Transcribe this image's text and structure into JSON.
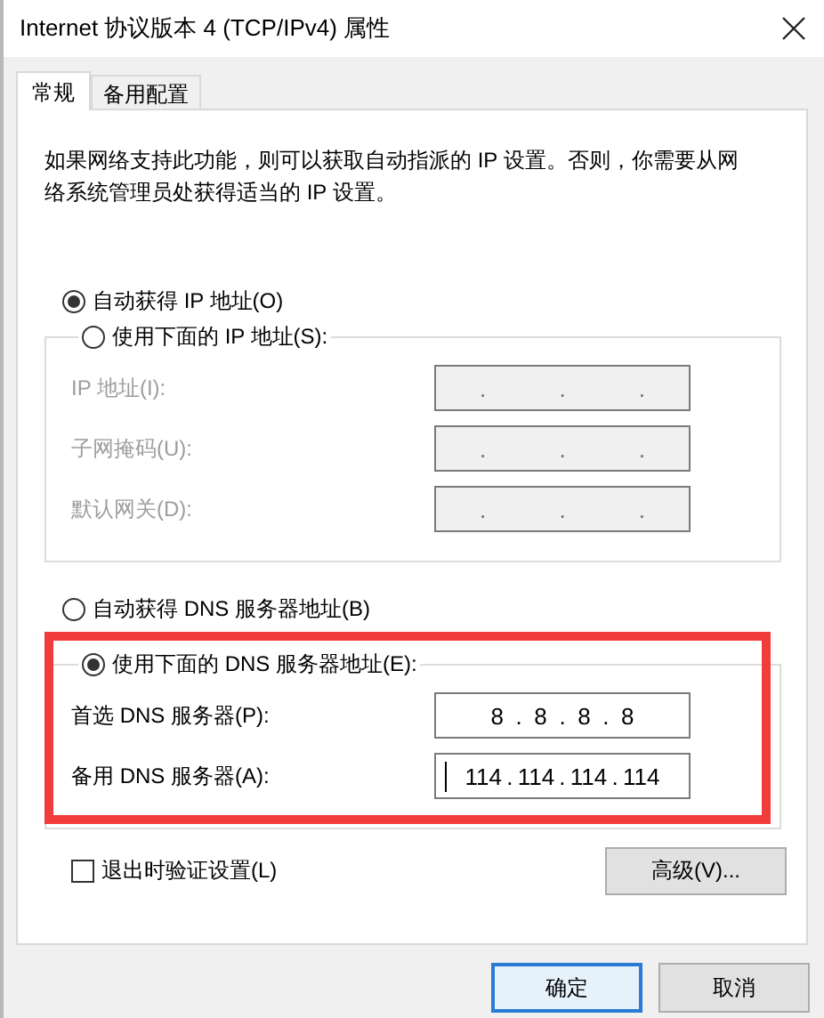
{
  "window": {
    "title": "Internet 协议版本 4 (TCP/IPv4) 属性"
  },
  "tabs": [
    {
      "label": "常规",
      "selected": true
    },
    {
      "label": "备用配置",
      "selected": false
    }
  ],
  "description": "如果网络支持此功能，则可以获取自动指派的 IP 设置。否则，你需要从网络系统管理员处获得适当的 IP 设置。",
  "ip_options": [
    {
      "label": "自动获得 IP 地址(O)",
      "selected": true
    },
    {
      "label": "使用下面的 IP 地址(S):",
      "selected": false
    }
  ],
  "ip_fields": [
    {
      "label": "IP 地址(I):",
      "value": ". . .",
      "disabled": true,
      "focused": false
    },
    {
      "label": "子网掩码(U):",
      "value": ". . .",
      "disabled": true,
      "focused": false
    },
    {
      "label": "默认网关(D):",
      "value": ". . .",
      "disabled": true,
      "focused": false
    }
  ],
  "dns_options": [
    {
      "label": "自动获得 DNS 服务器地址(B)",
      "selected": false
    },
    {
      "label": "使用下面的 DNS 服务器地址(E):",
      "selected": true
    }
  ],
  "dns_fields": [
    {
      "label": "首选 DNS 服务器(P):",
      "value": "8 . 8 . 8 . 8",
      "disabled": false,
      "focused": false
    },
    {
      "label": "备用 DNS 服务器(A):",
      "value": "114 . 114 . 114 . 114",
      "disabled": false,
      "focused": true
    }
  ],
  "annotation": {
    "kind": "highlight-frame"
  },
  "validate_checkbox": {
    "label": "退出时验证设置(L)",
    "checked": false
  },
  "advanced_button": {
    "label": "高级(V)..."
  },
  "buttons": [
    {
      "label": "确定",
      "default": true
    },
    {
      "label": "取消",
      "default": false
    }
  ]
}
